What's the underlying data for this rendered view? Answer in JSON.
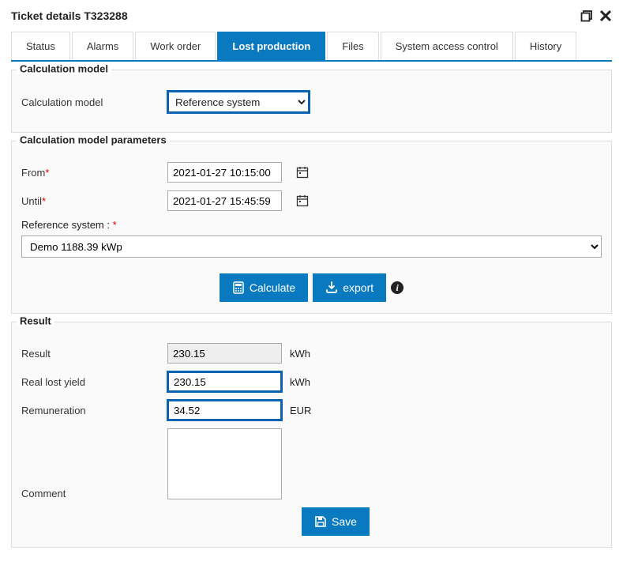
{
  "header": {
    "title": "Ticket details T323288"
  },
  "tabs": {
    "status": "Status",
    "alarms": "Alarms",
    "work_order": "Work order",
    "lost_production": "Lost production",
    "files": "Files",
    "system_access": "System access control",
    "history": "History"
  },
  "calc_model_section": {
    "title": "Calculation model",
    "label": "Calculation model",
    "value": "Reference system"
  },
  "params_section": {
    "title": "Calculation model parameters",
    "from_label": "From",
    "from_value": "2021-01-27 10:15:00",
    "until_label": "Until",
    "until_value": "2021-01-27 15:45:59",
    "ref_label": "Reference system : ",
    "ref_value": "Demo 1188.39 kWp",
    "calculate_btn": "Calculate",
    "export_btn": "export"
  },
  "result_section": {
    "title": "Result",
    "result_label": "Result",
    "result_value": "230.15",
    "result_unit": "kWh",
    "real_label": "Real lost yield",
    "real_value": "230.15",
    "real_unit": "kWh",
    "remun_label": "Remuneration",
    "remun_value": "34.52",
    "remun_unit": "EUR",
    "comment_label": "Comment",
    "comment_value": "",
    "save_btn": "Save"
  }
}
